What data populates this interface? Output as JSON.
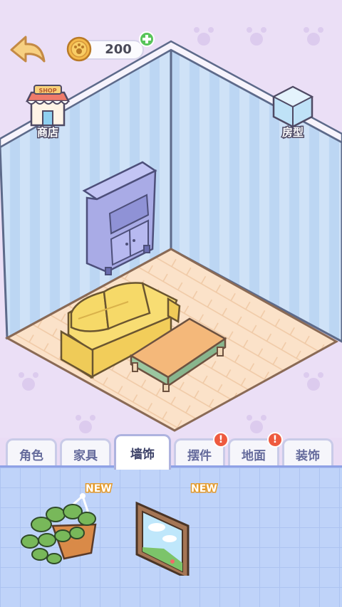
{
  "header": {
    "coins": "200"
  },
  "scene_buttons": {
    "shop_label": "商店",
    "shop_sign": "SHOP",
    "room_label": "房型"
  },
  "tabs": [
    {
      "label": "角色",
      "active": false,
      "alert": false
    },
    {
      "label": "家具",
      "active": false,
      "alert": false
    },
    {
      "label": "墙饰",
      "active": true,
      "alert": false
    },
    {
      "label": "摆件",
      "active": false,
      "alert": true
    },
    {
      "label": "地面",
      "active": false,
      "alert": true
    },
    {
      "label": "装饰",
      "active": false,
      "alert": false
    }
  ],
  "alert_mark": "!",
  "items": [
    {
      "name": "hanging-plant",
      "tag": "NEW"
    },
    {
      "name": "window-painting",
      "tag": "NEW"
    }
  ],
  "colors": {
    "wall": "#b9d4f2",
    "floor": "#f9dcc0",
    "sofa": "#f6d968",
    "table_top": "#f4b87a",
    "cabinet": "#a9abe6",
    "panel": "#bfd3f9",
    "badge": "#ee5a3f"
  }
}
